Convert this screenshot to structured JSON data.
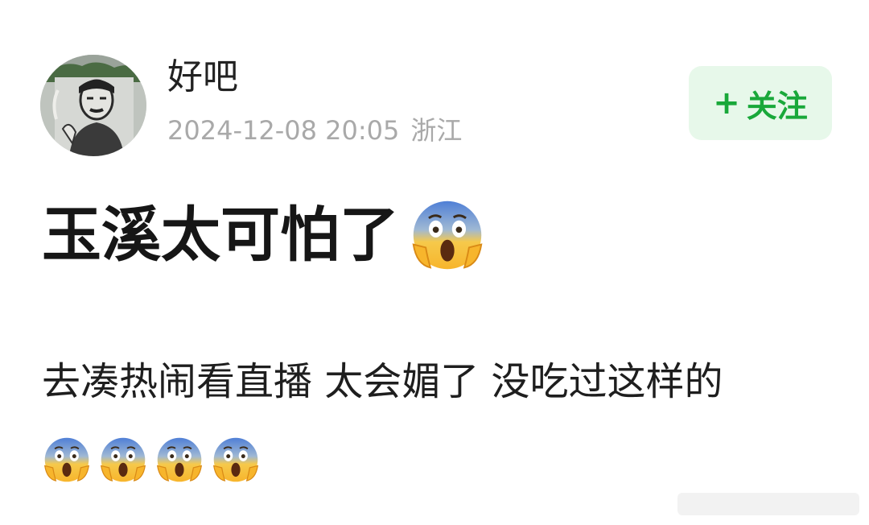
{
  "post": {
    "author": "好吧",
    "date": "2024-12-08 20:05",
    "location": "浙江",
    "follow_label": "关注",
    "follow_plus": "+",
    "title": "玉溪太可怕了",
    "body": "去凑热闹看直播 太会媚了 没吃过这样的",
    "title_emoji": "screaming-face-icon",
    "body_emojis": [
      "screaming-face-icon",
      "screaming-face-icon",
      "screaming-face-icon",
      "screaming-face-icon"
    ]
  },
  "colors": {
    "follow_bg": "#e7f8ea",
    "follow_text": "#19a83a",
    "meta_text": "#a9a9a9",
    "title_text": "#161616"
  }
}
